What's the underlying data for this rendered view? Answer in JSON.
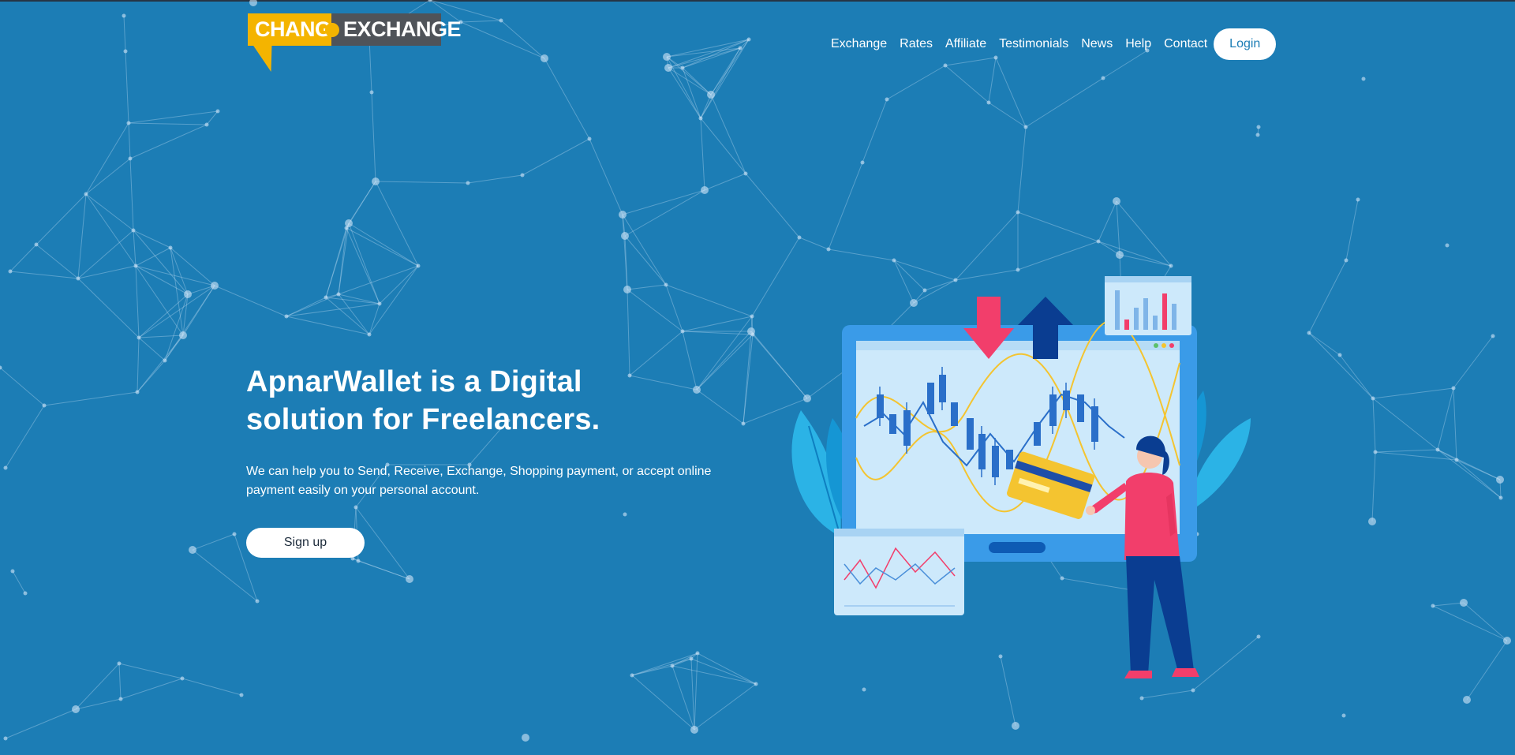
{
  "logo": {
    "left": "CHANGE",
    "right": "EXCHANGE"
  },
  "nav": {
    "items": [
      "Exchange",
      "Rates",
      "Affiliate",
      "Testimonials",
      "News",
      "Help",
      "Contact"
    ],
    "login": "Login"
  },
  "hero": {
    "title_line1": "ApnarWallet is a Digital",
    "title_line2": "solution for Freelancers.",
    "description": "We can help you to Send, Receive, Exchange, Shopping payment, or accept online payment easily on your personal account.",
    "cta": "Sign up"
  },
  "colors": {
    "background": "#1c7db5",
    "logo_yellow": "#f4b400",
    "logo_gray": "#4f5359",
    "accent_pink": "#f23e6b",
    "navy": "#0a3d91"
  },
  "icons": [
    "down-arrow-icon",
    "up-arrow-icon",
    "credit-card-icon",
    "bar-chart-icon",
    "line-chart-icon",
    "candlestick-chart-icon"
  ]
}
